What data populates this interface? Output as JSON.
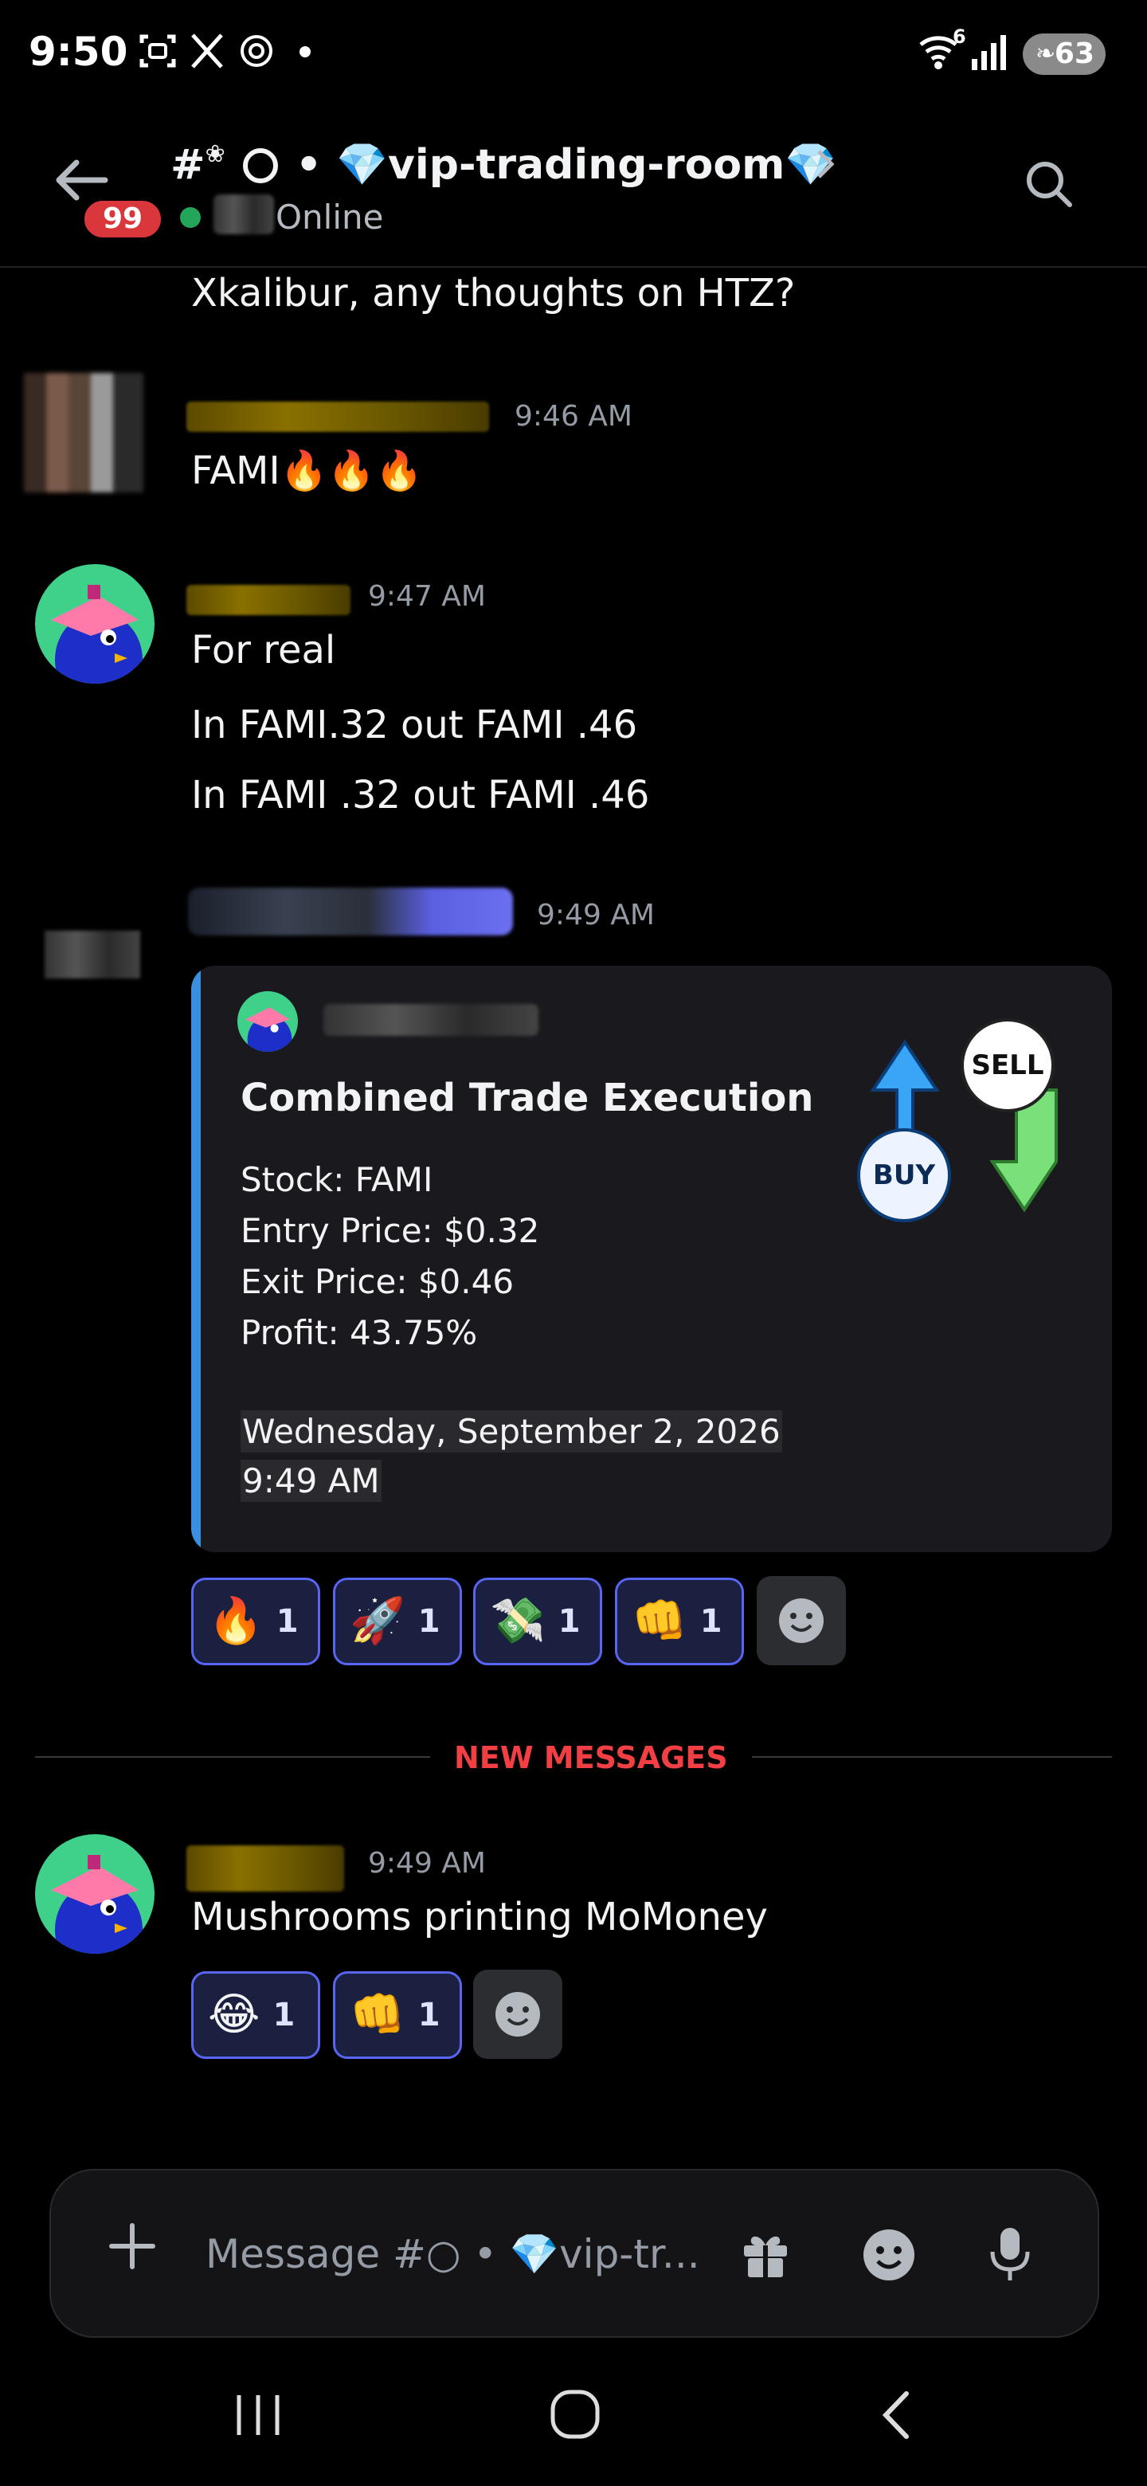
{
  "status_bar": {
    "time": "9:50",
    "wifi_badge": "6",
    "battery": "63",
    "icons": [
      "screenshot-icon",
      "x-app-icon",
      "chatgpt-icon",
      "notification-dot"
    ]
  },
  "header": {
    "channel_prefix": "#",
    "channel_name": "• 💎vip-trading-room💎",
    "unread_badge": "99",
    "status": "Online"
  },
  "messages": [
    {
      "id": "m0",
      "text": "Xkalibur, any thoughts on HTZ?"
    },
    {
      "id": "m1",
      "timestamp": "9:46 AM",
      "text": "FAMI🔥🔥🔥"
    },
    {
      "id": "m2",
      "timestamp": "9:47 AM",
      "lines": [
        "For real",
        "In FAMI.32 out FAMI .46",
        "In FAMI .32 out FAMI .46"
      ]
    },
    {
      "id": "m3",
      "timestamp": "9:49 AM"
    }
  ],
  "embed": {
    "title": "Combined Trade Execution",
    "lines": [
      "Stock: FAMI",
      "Entry Price: $0.32",
      "Exit Price: $0.46",
      "Profit: 43.75%"
    ],
    "date": "Wednesday, September 2, 2026",
    "time": "9:49 AM",
    "thumb": {
      "buy": "BUY",
      "sell": "SELL"
    }
  },
  "reactions_trade": [
    {
      "emoji": "🔥",
      "count": "1"
    },
    {
      "emoji": "🚀",
      "count": "1"
    },
    {
      "emoji": "💸",
      "count": "1"
    },
    {
      "emoji": "👊",
      "count": "1"
    }
  ],
  "new_messages_label": "NEW MESSAGES",
  "last_message": {
    "timestamp": "9:49 AM",
    "text": "Mushrooms printing MoMoney"
  },
  "reactions_last": [
    {
      "emoji": "😂",
      "count": "1"
    },
    {
      "emoji": "👊",
      "count": "1"
    }
  ],
  "composer": {
    "placeholder": "Message #○ • 💎vip-tr..."
  },
  "colors": {
    "accent": "#5865f2",
    "new_messages": "#f23f43",
    "online": "#23a55a",
    "badge": "#da373c",
    "embed_bar": "#3b8fe0"
  }
}
